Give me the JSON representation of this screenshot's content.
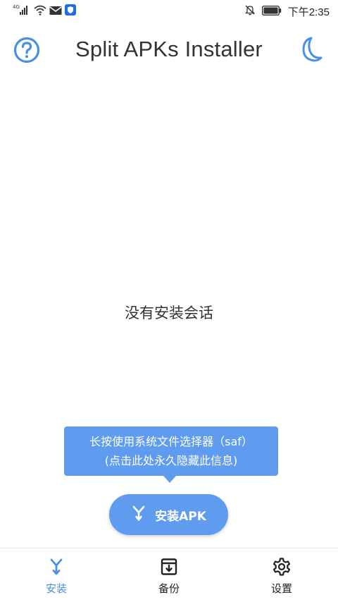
{
  "status_bar": {
    "network": "4G",
    "time": "下午2:35",
    "icons": [
      "signal-icon",
      "wifi-icon",
      "mail-icon",
      "shield-icon",
      "mute-bell-icon",
      "battery-icon"
    ]
  },
  "app_bar": {
    "title": "Split APKs Installer",
    "help_icon": "help-circle-icon",
    "theme_icon": "moon-icon"
  },
  "main": {
    "empty_message": "没有安装会话"
  },
  "tooltip": {
    "line1": "长按使用系统文件选择器（saf）",
    "line2": "(点击此处永久隐藏此信息)"
  },
  "fab": {
    "label": "安装APK",
    "icon": "merge-icon"
  },
  "bottom_nav": {
    "items": [
      {
        "label": "安装",
        "icon": "merge-icon",
        "active": true
      },
      {
        "label": "备份",
        "icon": "archive-icon",
        "active": false
      },
      {
        "label": "设置",
        "icon": "gear-icon",
        "active": false
      }
    ]
  },
  "colors": {
    "accent": "#5f9cf0",
    "icon_blue": "#4a90e2",
    "text": "#333333",
    "nav_inactive": "#222222"
  }
}
